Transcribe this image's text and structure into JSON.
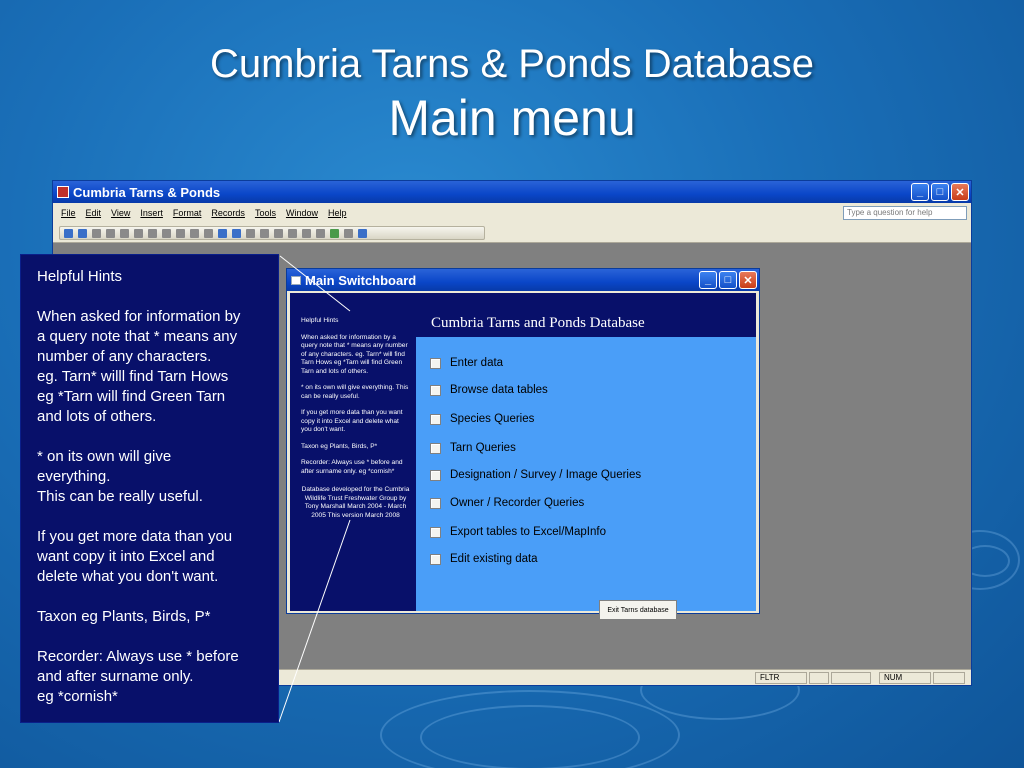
{
  "slide": {
    "title_line1": "Cumbria Tarns & Ponds Database",
    "title_line2": "Main menu"
  },
  "access_window": {
    "title": "Cumbria Tarns & Ponds",
    "menu": [
      "File",
      "Edit",
      "View",
      "Insert",
      "Format",
      "Records",
      "Tools",
      "Window",
      "Help"
    ],
    "help_placeholder": "Type a question for help",
    "status": {
      "fltr": "FLTR",
      "num": "NUM"
    }
  },
  "switchboard": {
    "title": "Main Switchboard",
    "header": "Cumbria Tarns and Ponds Database",
    "side_hints": {
      "heading": "Helpful Hints",
      "p1": "When asked for information by a query note that * means any number of any characters. eg. Tarn* will find Tarn Hows eg *Tarn will find Green Tarn and lots of others.",
      "p2": "* on its own will give everything. This can be really useful.",
      "p3": "If you get more data than you want copy it into Excel and delete what you don't want.",
      "p4": "Taxon eg Plants, Birds, P*",
      "p5": "Recorder: Always use * before and after surname only. eg *cornish*",
      "credit": "Database developed for the Cumbria Wildlife Trust Freshwater Group by Tony Marshall March 2004 - March 2005 This version March 2008"
    },
    "items": [
      "Enter data",
      "Browse data tables",
      "Species Queries",
      "Tarn Queries",
      "Designation / Survey / Image Queries",
      "Owner / Recorder Queries",
      "Export tables to Excel/MapInfo",
      "Edit existing data"
    ],
    "exit_label": "Exit Tarns database"
  },
  "hints_callout": {
    "heading": "Helpful Hints",
    "p1": "When asked for information by\na query note that * means any\nnumber of any characters.\neg. Tarn* willl find Tarn Hows\neg *Tarn will find Green Tarn\nand lots of others.",
    "p2": "* on its own will give\neverything.\nThis can be really useful.",
    "p3": "If you get more data than you\nwant copy it into Excel and\ndelete what you don't want.",
    "p4": "Taxon eg Plants, Birds, P*",
    "p5": "Recorder: Always use * before\nand after surname only.\neg *cornish*"
  }
}
